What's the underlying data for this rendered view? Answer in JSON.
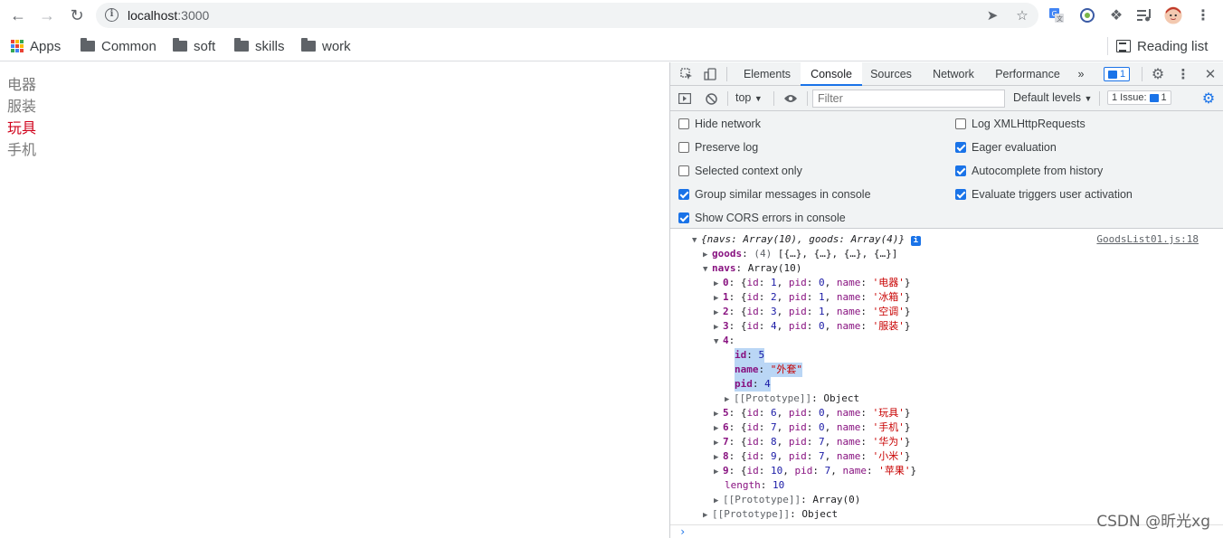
{
  "browser": {
    "url_host": "localhost",
    "url_port": ":3000",
    "reading_list_label": "Reading list",
    "bookmarks": [
      {
        "label": "Apps"
      },
      {
        "label": "Common"
      },
      {
        "label": "soft"
      },
      {
        "label": "skills"
      },
      {
        "label": "work"
      }
    ]
  },
  "page": {
    "items": [
      {
        "label": "电器",
        "active": false
      },
      {
        "label": "服装",
        "active": false
      },
      {
        "label": "玩具",
        "active": true
      },
      {
        "label": "手机",
        "active": false
      }
    ],
    "active_color": "#d0021b"
  },
  "devtools": {
    "tabs": [
      "Elements",
      "Console",
      "Sources",
      "Network",
      "Performance"
    ],
    "active_tab": "Console",
    "more_tabs": "»",
    "message_badge": "1",
    "context": "top",
    "filter_placeholder": "Filter",
    "levels": "Default levels",
    "issues_label": "1 Issue:",
    "issues_count": "1",
    "options_left": [
      {
        "label": "Hide network",
        "checked": false
      },
      {
        "label": "Preserve log",
        "checked": false
      },
      {
        "label": "Selected context only",
        "checked": false
      },
      {
        "label": "Group similar messages in console",
        "checked": true
      },
      {
        "label": "Show CORS errors in console",
        "checked": true
      }
    ],
    "options_right": [
      {
        "label": "Log XMLHttpRequests",
        "checked": false
      },
      {
        "label": "Eager evaluation",
        "checked": true
      },
      {
        "label": "Autocomplete from history",
        "checked": true
      },
      {
        "label": "Evaluate triggers user activation",
        "checked": true
      }
    ],
    "console": {
      "source_link": "GoodsList01.js:18",
      "summary": "{navs: Array(10), goods: Array(4)}",
      "goods_line": {
        "key": "goods",
        "count": "(4)",
        "preview": "[{…}, {…}, {…}, {…}]"
      },
      "navs_line": {
        "key": "navs",
        "type": "Array(10)"
      },
      "navs": [
        {
          "index": "0",
          "id": "1",
          "pid": "0",
          "name": "'电器'"
        },
        {
          "index": "1",
          "id": "2",
          "pid": "1",
          "name": "'冰箱'"
        },
        {
          "index": "2",
          "id": "3",
          "pid": "1",
          "name": "'空调'"
        },
        {
          "index": "3",
          "id": "4",
          "pid": "0",
          "name": "'服装'"
        }
      ],
      "expanded": {
        "index": "4",
        "id": "5",
        "name": "\"外套\"",
        "pid": "4",
        "proto": "Object"
      },
      "navs_rest": [
        {
          "index": "5",
          "id": "6",
          "pid": "0",
          "name": "'玩具'"
        },
        {
          "index": "6",
          "id": "7",
          "pid": "0",
          "name": "'手机'"
        },
        {
          "index": "7",
          "id": "8",
          "pid": "7",
          "name": "'华为'"
        },
        {
          "index": "8",
          "id": "9",
          "pid": "7",
          "name": "'小米'"
        },
        {
          "index": "9",
          "id": "10",
          "pid": "7",
          "name": "'苹果'"
        }
      ],
      "length": "10",
      "navs_proto": "Array(0)",
      "root_proto": "Object"
    }
  },
  "watermark": "CSDN @昕光xg"
}
